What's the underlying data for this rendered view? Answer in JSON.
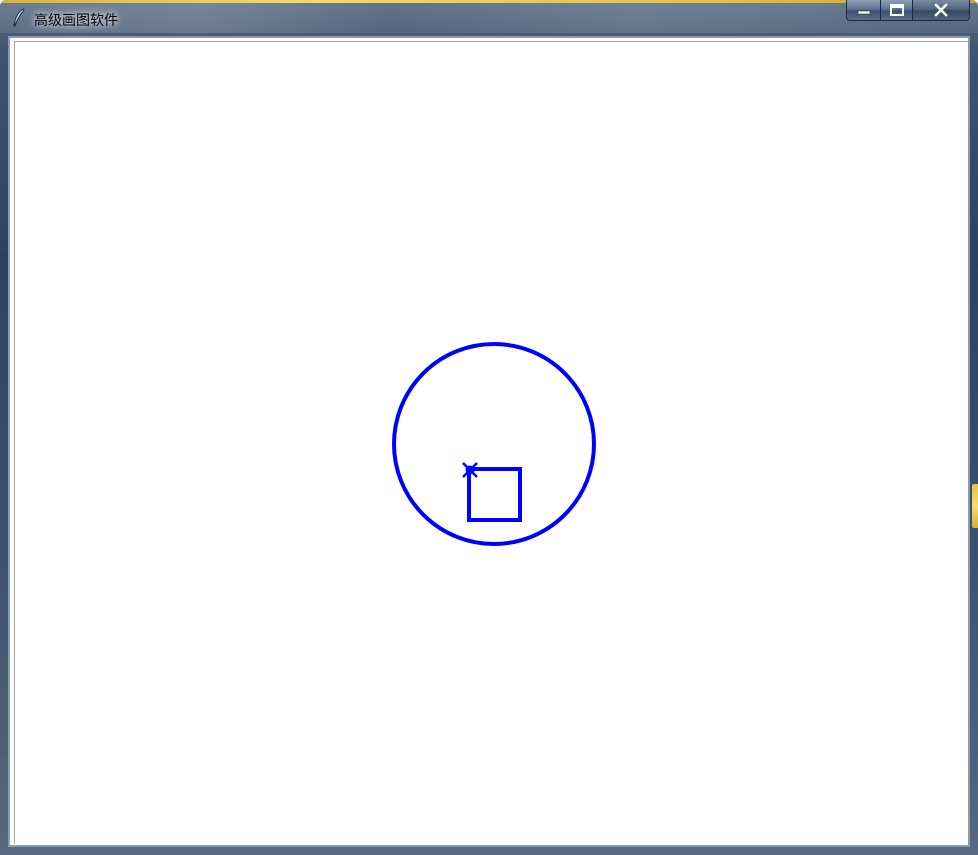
{
  "window": {
    "title": "高级画图软件",
    "app_icon": "feather-pen-icon",
    "buttons": {
      "minimize_icon": "minimize-icon",
      "maximize_icon": "maximize-icon",
      "close_icon": "close-icon"
    }
  },
  "canvas": {
    "background": "#ffffff",
    "stroke_color": "#0000ff",
    "shapes": [
      {
        "type": "circle",
        "name": "drawn-circle"
      },
      {
        "type": "square",
        "name": "drawn-square"
      },
      {
        "type": "cursor-marker",
        "name": "pen-cursor-marker"
      }
    ]
  },
  "colors": {
    "titlebar": "#2d4260",
    "accent": "#e3c24d",
    "drawing": "#0000ff"
  }
}
